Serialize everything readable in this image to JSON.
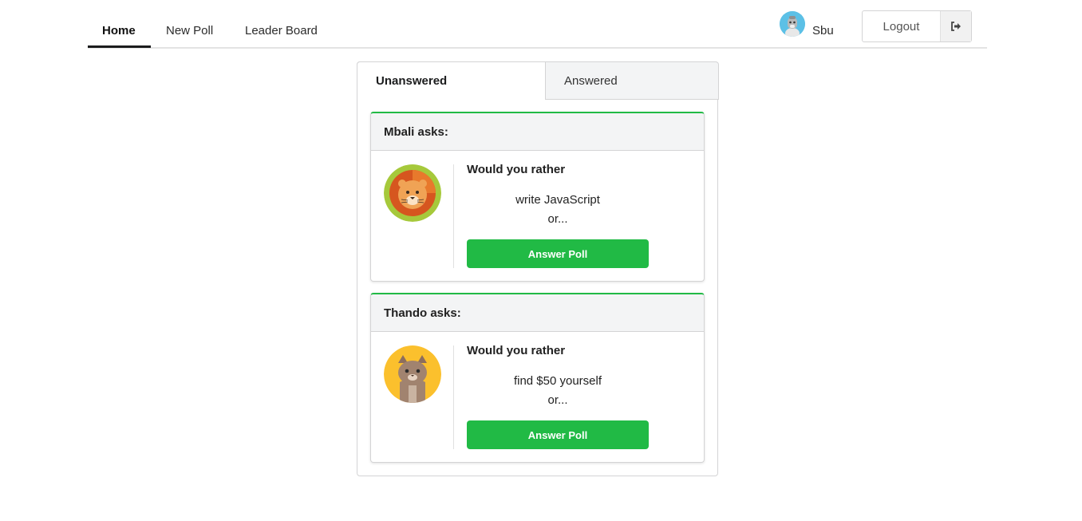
{
  "nav": {
    "items": [
      {
        "label": "Home"
      },
      {
        "label": "New Poll"
      },
      {
        "label": "Leader Board"
      }
    ],
    "user_name": "Sbu",
    "logout_label": "Logout"
  },
  "tabs": [
    {
      "label": "Unanswered",
      "selected": true
    },
    {
      "label": "Answered",
      "selected": false
    }
  ],
  "polls": [
    {
      "author_heading": "Mbali asks:",
      "prompt": "Would you rather",
      "option_one": "write JavaScript",
      "or_text": "or...",
      "button_label": "Answer Poll",
      "avatar_icon": "lion-avatar-icon"
    },
    {
      "author_heading": "Thando asks:",
      "prompt": "Would you rather",
      "option_one": "find $50 yourself",
      "or_text": "or...",
      "button_label": "Answer Poll",
      "avatar_icon": "cat-avatar-icon"
    }
  ],
  "colors": {
    "accent_green": "#21ba45",
    "header_gray": "#f3f4f5",
    "border": "#d4d4d5"
  }
}
